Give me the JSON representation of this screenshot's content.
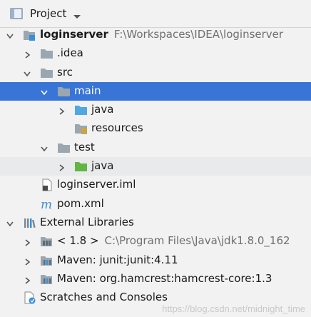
{
  "header": {
    "title": "Project",
    "icon": "project-window-icon"
  },
  "tree": {
    "root": {
      "name": "loginserver",
      "path": "F:\\Workspaces\\IDEA\\loginserver"
    },
    "idea": ".idea",
    "src": "src",
    "main": "main",
    "main_java": "java",
    "resources": "resources",
    "test": "test",
    "test_java": "java",
    "iml": "loginserver.iml",
    "pom": "pom.xml",
    "external_libraries": "External Libraries",
    "jdk": {
      "name": "< 1.8 >",
      "path": "C:\\Program Files\\Java\\jdk1.8.0_162"
    },
    "maven_junit": "Maven: junit:junit:4.11",
    "maven_hamcrest": "Maven: org.hamcrest:hamcrest-core:1.3",
    "scratches": "Scratches and Consoles"
  },
  "watermark": "https://blog.csdn.net/midnight_time",
  "colors": {
    "selection": "#3875d7",
    "folder_gray": "#9aa7b0",
    "folder_blue": "#4fa8e0",
    "folder_green": "#62b543"
  }
}
